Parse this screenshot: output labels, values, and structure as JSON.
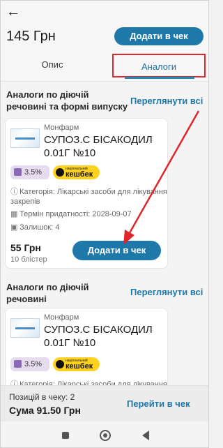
{
  "header": {
    "back_icon": "arrow-left-icon",
    "price": "145 Грн",
    "add_button": "Додати в чек"
  },
  "tabs": {
    "description": "Опис",
    "analogs": "Аналоги"
  },
  "sections": [
    {
      "title": "Аналоги по діючій речовині та формі випуску",
      "see_all": "Переглянути всі",
      "card": {
        "manufacturer": "Монфарм",
        "name": "СУПОЗ.С БІСАКОДИЛ 0.01Г №10",
        "percent": "3.5%",
        "cashback_small": "національний",
        "cashback": "кешбек",
        "category": "Категорія: Лікарські засоби для лікування закрепів",
        "expiry": "Термін придатності: 2028-09-07",
        "stock": "Залишок: 4",
        "price": "55 Грн",
        "unit": "10 блістер",
        "add_button": "Додати в чек"
      }
    },
    {
      "title": "Аналоги по діючій речовині",
      "see_all": "Переглянути всі",
      "card": {
        "manufacturer": "Монфарм",
        "name": "СУПОЗ.С БІСАКОДИЛ 0.01Г №10",
        "percent": "3.5%",
        "cashback_small": "національний",
        "cashback": "кешбек",
        "category": "Категорія: Лікарські засоби для лікування закрепів"
      }
    }
  ],
  "footer": {
    "positions": "Позицій в чеку: 2",
    "sum": "Сума 91.50 Грн",
    "goto": "Перейти в чек"
  },
  "colors": {
    "primary": "#1f78aa",
    "highlight": "#e0262a",
    "cashback": "#ffd21f"
  }
}
